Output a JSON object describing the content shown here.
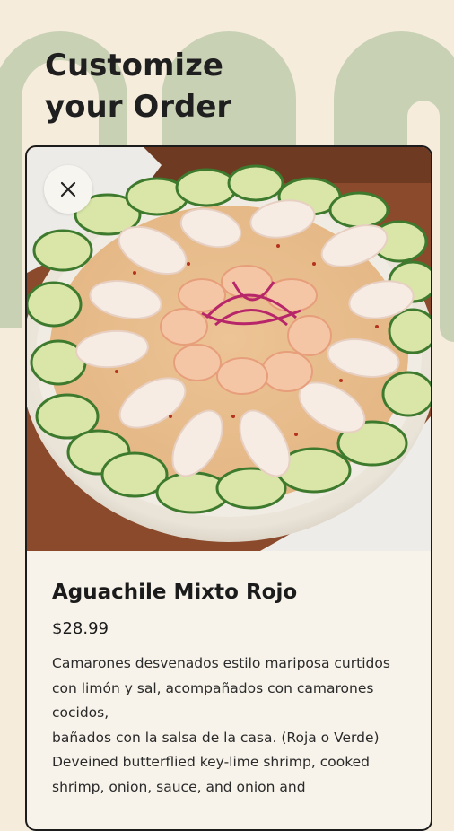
{
  "page": {
    "headline": "Customize\nyour Order"
  },
  "theme": {
    "background": "#f5ecdc",
    "arch_color": "#c9d1b5",
    "card_border": "#1c1c1c"
  },
  "item": {
    "image_icon": "food-photo",
    "close_icon": "close-icon",
    "name": "Aguachile Mixto Rojo",
    "price": "$28.99",
    "description": "Camarones desvenados estilo mariposa curtidos con limón y sal, acompañados con camarones cocidos,\nbañados con la salsa de la casa. (Roja o Verde)\nDeveined butterflied key-lime shrimp, cooked shrimp, onion, sauce, and onion and"
  }
}
